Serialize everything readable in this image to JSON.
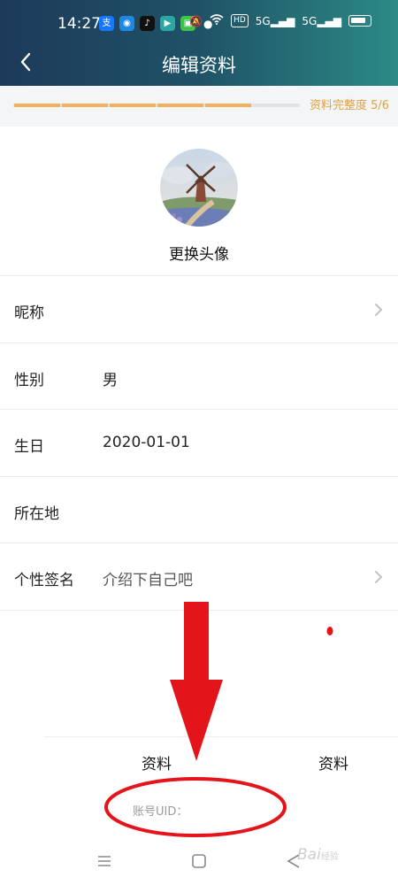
{
  "status_bar": {
    "time": "14:27",
    "app_icons": [
      {
        "name": "alipay-icon",
        "glyph": "支",
        "color": "#1677ff"
      },
      {
        "name": "circle-app-icon",
        "glyph": "◉",
        "color": "#1e88e5"
      },
      {
        "name": "tiktok-icon",
        "glyph": "♪",
        "color": "#111111"
      },
      {
        "name": "video-app-icon",
        "glyph": "▶",
        "color": "#2aa7a0"
      },
      {
        "name": "green-app-icon",
        "glyph": "▣",
        "color": "#3cc24d"
      }
    ],
    "signal_labels": [
      "HD",
      "5G",
      "5G"
    ]
  },
  "header": {
    "title": "编辑资料"
  },
  "progress": {
    "label": "资料完整度 5/6",
    "completed": 5,
    "total": 6,
    "fill_color": "#f0b25e"
  },
  "profile": {
    "change_avatar_label": "更换头像"
  },
  "fields": [
    {
      "label": "昵称",
      "value": "",
      "chevron": true
    },
    {
      "label": "性别",
      "value": "男",
      "chevron": false
    },
    {
      "label": "生日",
      "value": "2020-01-01",
      "chevron": false
    },
    {
      "label": "所在地",
      "value": "",
      "chevron": false
    },
    {
      "label": "个性签名",
      "value": "介绍下自己吧",
      "chevron": true
    }
  ],
  "bottom": {
    "tab_left": "资料",
    "tab_right": "资料",
    "uid_label": "账号UID："
  },
  "watermark": {
    "text": "Bai",
    "suffix": "经验"
  },
  "colors": {
    "annotation_red": "#e4141b",
    "accent": "#e0a13e"
  }
}
